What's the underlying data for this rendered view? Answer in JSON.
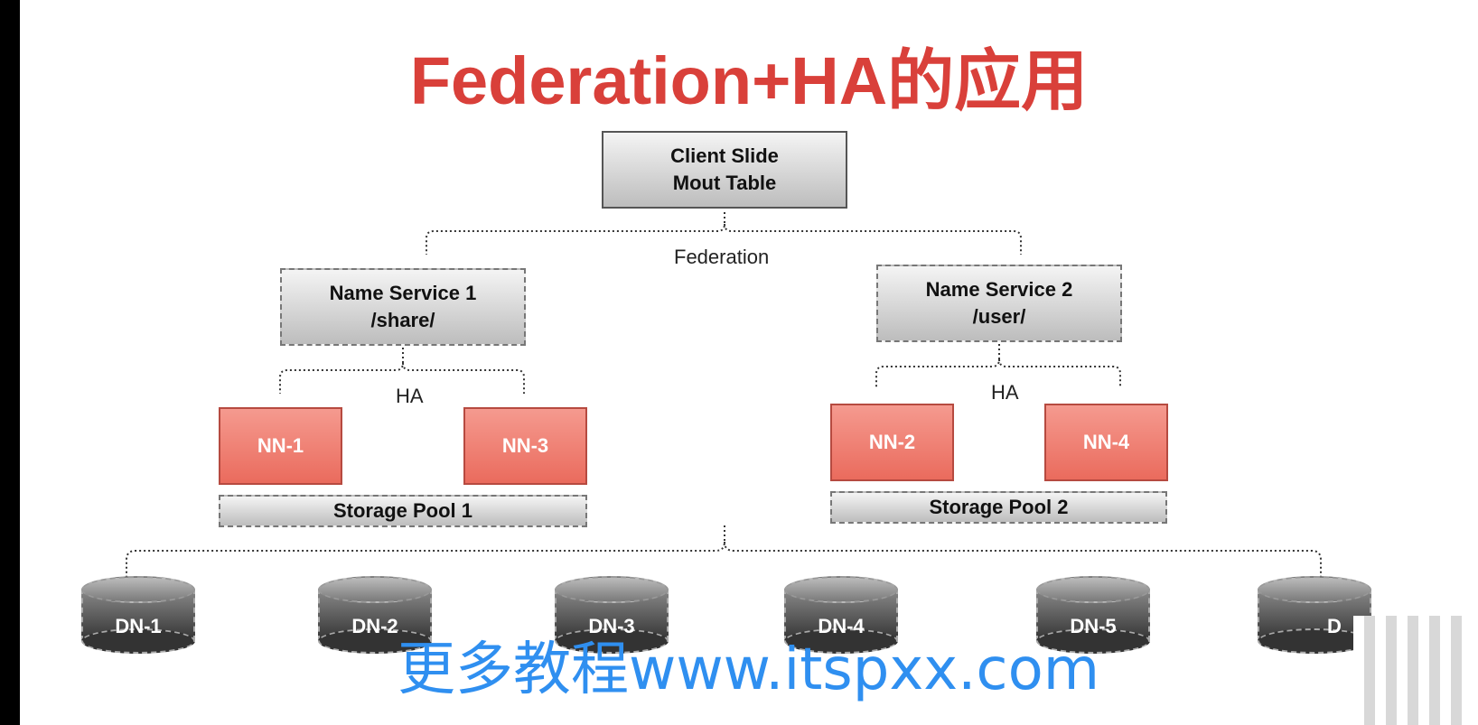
{
  "title": "Federation+HA的应用",
  "client": {
    "line1": "Client Slide",
    "line2": "Mout Table"
  },
  "federation_label": "Federation",
  "name_services": [
    {
      "line1": "Name Service 1",
      "line2": "/share/",
      "ha_label": "HA",
      "namenodes": [
        "NN-1",
        "NN-3"
      ],
      "pool": "Storage Pool 1"
    },
    {
      "line1": "Name Service 2",
      "line2": "/user/",
      "ha_label": "HA",
      "namenodes": [
        "NN-2",
        "NN-4"
      ],
      "pool": "Storage Pool 2"
    }
  ],
  "datanodes": [
    "DN-1",
    "DN-2",
    "DN-3",
    "DN-4",
    "DN-5",
    "D"
  ],
  "watermark": "更多教程www.itspxx.com",
  "colors": {
    "title": "#d9403a",
    "namenode": "#ec7a6d",
    "watermark": "#2f8ff0"
  }
}
